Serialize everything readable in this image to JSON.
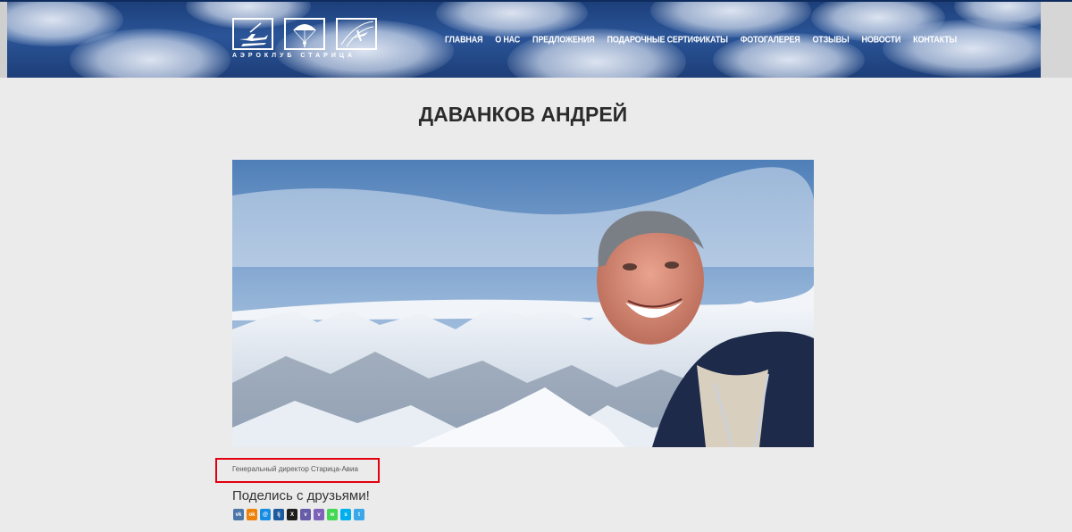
{
  "header": {
    "logo_text": "АЭРОКЛУБ СТАРИЦА",
    "nav": [
      "ГЛАВНАЯ",
      "О НАС",
      "ПРЕДЛОЖЕНИЯ",
      "ПОДАРОЧНЫЕ СЕРТИФИКАТЫ",
      "ФОТОГАЛЕРЕЯ",
      "ОТЗЫВЫ",
      "НОВОСТИ",
      "КОНТАКТЫ"
    ]
  },
  "main": {
    "title": "ДАВАНКОВ АНДРЕЙ",
    "caption": "Генеральный директор Старица-Авиа",
    "share_title": "Поделись с друзьями!"
  },
  "share": [
    {
      "icon": "vk-icon",
      "glyph": "vk",
      "color": "#4a76a8"
    },
    {
      "icon": "odnoklassniki-icon",
      "glyph": "ok",
      "color": "#ee8208"
    },
    {
      "icon": "mailru-icon",
      "glyph": "@",
      "color": "#168de2"
    },
    {
      "icon": "livejournal-icon",
      "glyph": "lj",
      "color": "#1d5b9f"
    },
    {
      "icon": "x-icon",
      "glyph": "X",
      "color": "#1d1d1d"
    },
    {
      "icon": "viber-icon",
      "glyph": "v",
      "color": "#665ca7"
    },
    {
      "icon": "viber2-icon",
      "glyph": "v",
      "color": "#7d62b8"
    },
    {
      "icon": "whatsapp-icon",
      "glyph": "w",
      "color": "#43d854"
    },
    {
      "icon": "skype-icon",
      "glyph": "s",
      "color": "#00aff0"
    },
    {
      "icon": "telegram-icon",
      "glyph": "t",
      "color": "#3aa8e8"
    }
  ]
}
